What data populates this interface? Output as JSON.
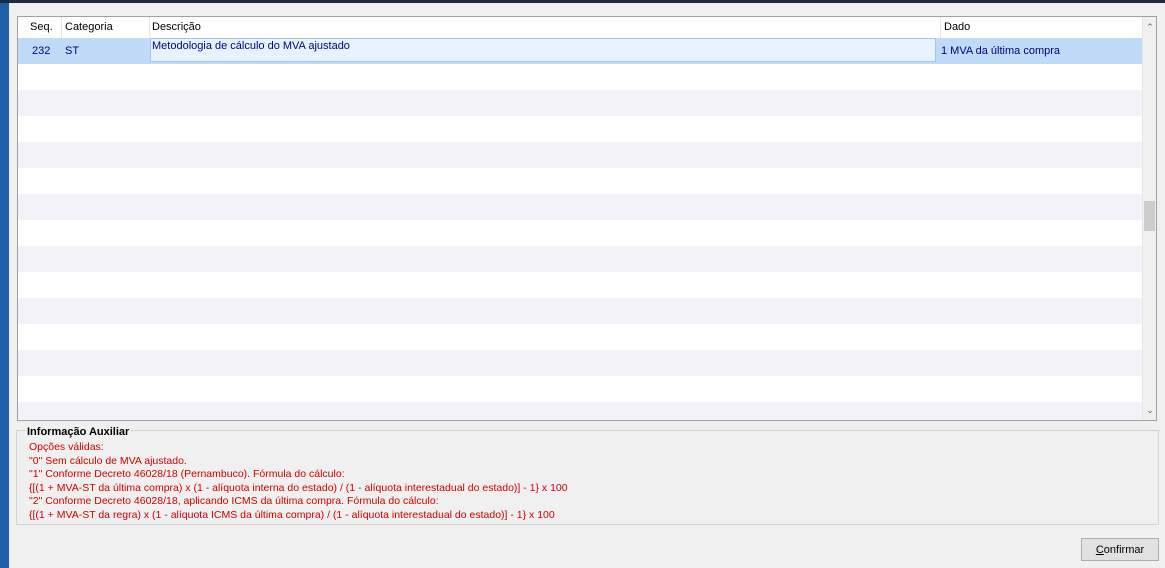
{
  "grid": {
    "columns": [
      {
        "label": "Seq."
      },
      {
        "label": "Categoria"
      },
      {
        "label": "Descrição"
      },
      {
        "label": "Dado"
      }
    ],
    "rows": [
      {
        "seq": "232",
        "categoria": "ST",
        "descricao": "Metodologia de cálculo do MVA ajustado",
        "dado": "1 MVA da última compra"
      }
    ]
  },
  "info": {
    "title": "Informação Auxiliar",
    "lines": [
      "Opções válidas:",
      "\"0\" Sem cálculo de MVA ajustado.",
      "\"1\" Conforme Decreto 46028/18 (Pernambuco). Fórmula do cálculo:",
      "{[(1 + MVA-ST da última compra) x (1 - alíquota interna do estado) / (1 - alíquota interestadual do estado)] - 1} x 100",
      "\"2\" Conforme Decreto 46028/18, aplicando ICMS da última compra. Fórmula do cálculo:",
      "{[(1 + MVA-ST da regra) x (1 - alíquota ICMS da última compra) / (1 - alíquota interestadual do estado)] - 1} x 100"
    ]
  },
  "buttons": {
    "confirm_accel": "C",
    "confirm_rest": "onfirmar"
  },
  "colors": {
    "selected_row": "#c0dbf7",
    "alt_row": "#f2f2f8",
    "info_text": "#d00000"
  }
}
